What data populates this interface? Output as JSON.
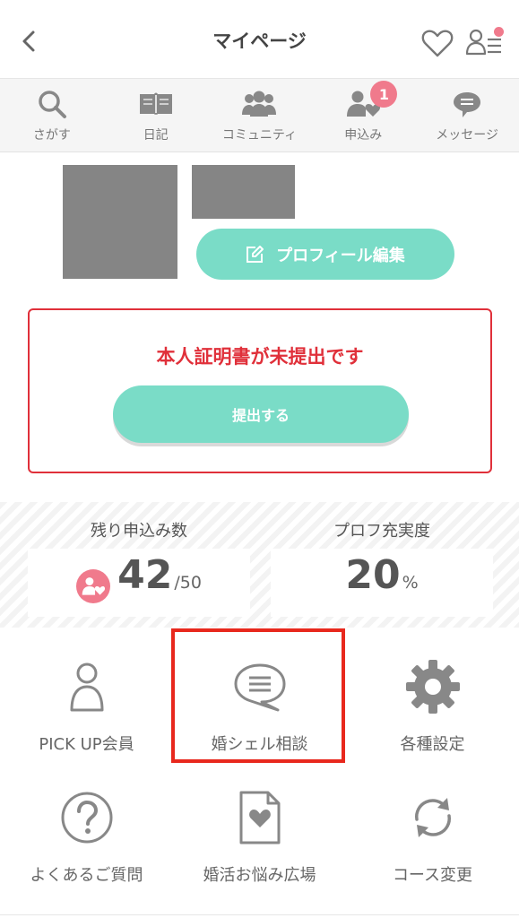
{
  "colors": {
    "accent": "#7adcc7",
    "alert": "#e0303a",
    "badge": "#f07a8c",
    "icon": "#888888",
    "highlight": "#e8281d"
  },
  "header": {
    "title": "マイページ",
    "back_icon": "chevron-left",
    "favorite_icon": "heart-outline",
    "menu_icon": "user-list"
  },
  "nav": {
    "items": [
      {
        "label": "さがす",
        "icon": "search"
      },
      {
        "label": "日記",
        "icon": "book"
      },
      {
        "label": "コミュニティ",
        "icon": "group"
      },
      {
        "label": "申込み",
        "icon": "person-heart",
        "badge": "1"
      },
      {
        "label": "メッセージ",
        "icon": "chat-bubble"
      }
    ]
  },
  "profile": {
    "edit_label": "プロフィール編集"
  },
  "verification": {
    "message": "本人証明書が未提出です",
    "submit_label": "提出する"
  },
  "stats": {
    "remaining": {
      "label": "残り申込み数",
      "value": "42",
      "total": "/50"
    },
    "completeness": {
      "label": "プロフ充実度",
      "value": "20",
      "unit": "%"
    }
  },
  "menu": {
    "items": [
      {
        "label": "PICK UP会員",
        "icon": "person"
      },
      {
        "label": "婚シェル相談",
        "icon": "speech-bubble"
      },
      {
        "label": "各種設定",
        "icon": "gear"
      },
      {
        "label": "よくあるご質問",
        "icon": "question"
      },
      {
        "label": "婚活お悩み広場",
        "icon": "document-heart"
      },
      {
        "label": "コース変更",
        "icon": "refresh"
      }
    ]
  }
}
